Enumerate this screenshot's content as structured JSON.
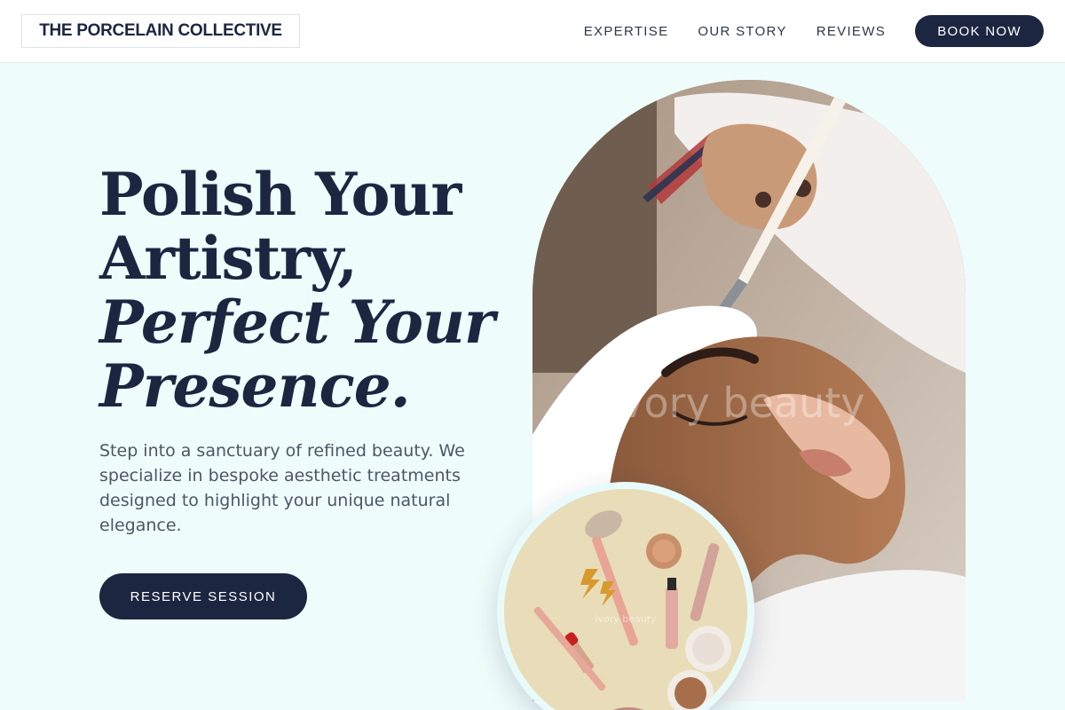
{
  "header": {
    "logo_text": "THE PORCELAIN COLLECTIVE",
    "nav": [
      {
        "label": "EXPERTISE"
      },
      {
        "label": "OUR STORY"
      },
      {
        "label": "REVIEWS"
      }
    ],
    "cta_label": "BOOK NOW"
  },
  "hero": {
    "title_line1": "Polish Your",
    "title_line2": "Artistry,",
    "title_line3": "Perfect Your",
    "title_line4": "Presence.",
    "description": "Step into a sanctuary of refined beauty. We specialize in bespoke aesthetic treatments designed to highlight your unique natural elegance.",
    "cta_label": "RESERVE SESSION"
  },
  "images": {
    "main_watermark": "ivory beauty",
    "circle_watermark": "ivory beauty"
  },
  "colors": {
    "primary": "#1c2640",
    "background": "#effcfc",
    "header_bg": "#ffffff",
    "body_text": "#4d5666"
  }
}
